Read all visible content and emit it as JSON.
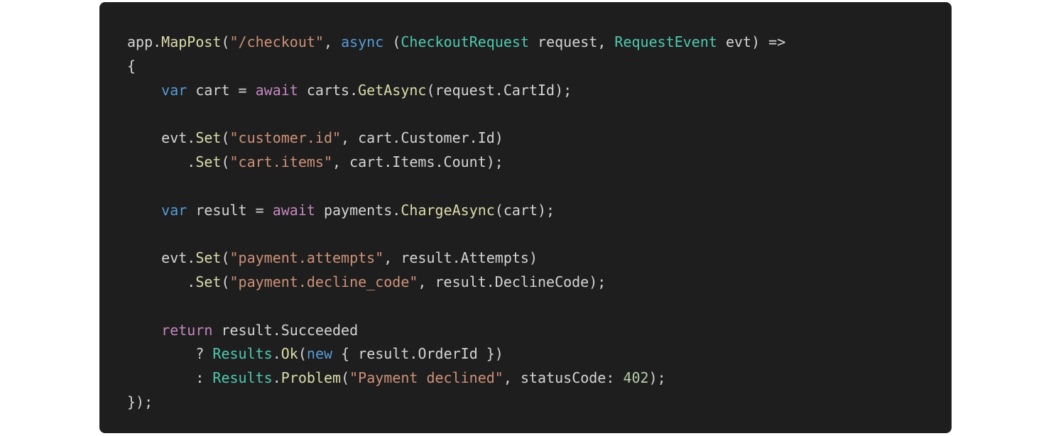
{
  "code_block": {
    "language": "csharp",
    "colors": {
      "background": "#1e1e1e",
      "plain": "#d4d4d4",
      "method": "#dcdcaa",
      "string": "#ce9178",
      "keyword": "#569cd6",
      "control": "#c586c0",
      "type": "#4ec9b0",
      "number": "#b5cea8"
    },
    "lines": [
      [
        {
          "t": "app.",
          "k": "plain"
        },
        {
          "t": "MapPost",
          "k": "method"
        },
        {
          "t": "(",
          "k": "plain"
        },
        {
          "t": "\"/checkout\"",
          "k": "string"
        },
        {
          "t": ", ",
          "k": "plain"
        },
        {
          "t": "async",
          "k": "keyword"
        },
        {
          "t": " (",
          "k": "plain"
        },
        {
          "t": "CheckoutRequest",
          "k": "type"
        },
        {
          "t": " request, ",
          "k": "plain"
        },
        {
          "t": "RequestEvent",
          "k": "type"
        },
        {
          "t": " evt) =>",
          "k": "plain"
        }
      ],
      [
        {
          "t": "{",
          "k": "plain"
        }
      ],
      [
        {
          "t": "    ",
          "k": "plain"
        },
        {
          "t": "var",
          "k": "keyword"
        },
        {
          "t": " cart = ",
          "k": "plain"
        },
        {
          "t": "await",
          "k": "control"
        },
        {
          "t": " carts.",
          "k": "plain"
        },
        {
          "t": "GetAsync",
          "k": "method"
        },
        {
          "t": "(request.CartId);",
          "k": "plain"
        }
      ],
      [],
      [
        {
          "t": "    evt.",
          "k": "plain"
        },
        {
          "t": "Set",
          "k": "method"
        },
        {
          "t": "(",
          "k": "plain"
        },
        {
          "t": "\"customer.id\"",
          "k": "string"
        },
        {
          "t": ", cart.Customer.Id)",
          "k": "plain"
        }
      ],
      [
        {
          "t": "       .",
          "k": "plain"
        },
        {
          "t": "Set",
          "k": "method"
        },
        {
          "t": "(",
          "k": "plain"
        },
        {
          "t": "\"cart.items\"",
          "k": "string"
        },
        {
          "t": ", cart.Items.Count);",
          "k": "plain"
        }
      ],
      [],
      [
        {
          "t": "    ",
          "k": "plain"
        },
        {
          "t": "var",
          "k": "keyword"
        },
        {
          "t": " result = ",
          "k": "plain"
        },
        {
          "t": "await",
          "k": "control"
        },
        {
          "t": " payments.",
          "k": "plain"
        },
        {
          "t": "ChargeAsync",
          "k": "method"
        },
        {
          "t": "(cart);",
          "k": "plain"
        }
      ],
      [],
      [
        {
          "t": "    evt.",
          "k": "plain"
        },
        {
          "t": "Set",
          "k": "method"
        },
        {
          "t": "(",
          "k": "plain"
        },
        {
          "t": "\"payment.attempts\"",
          "k": "string"
        },
        {
          "t": ", result.Attempts)",
          "k": "plain"
        }
      ],
      [
        {
          "t": "       .",
          "k": "plain"
        },
        {
          "t": "Set",
          "k": "method"
        },
        {
          "t": "(",
          "k": "plain"
        },
        {
          "t": "\"payment.decline_code\"",
          "k": "string"
        },
        {
          "t": ", result.DeclineCode);",
          "k": "plain"
        }
      ],
      [],
      [
        {
          "t": "    ",
          "k": "plain"
        },
        {
          "t": "return",
          "k": "control"
        },
        {
          "t": " result.Succeeded",
          "k": "plain"
        }
      ],
      [
        {
          "t": "        ? ",
          "k": "plain"
        },
        {
          "t": "Results",
          "k": "type"
        },
        {
          "t": ".",
          "k": "plain"
        },
        {
          "t": "Ok",
          "k": "method"
        },
        {
          "t": "(",
          "k": "plain"
        },
        {
          "t": "new",
          "k": "keyword"
        },
        {
          "t": " { result.OrderId })",
          "k": "plain"
        }
      ],
      [
        {
          "t": "        : ",
          "k": "plain"
        },
        {
          "t": "Results",
          "k": "type"
        },
        {
          "t": ".",
          "k": "plain"
        },
        {
          "t": "Problem",
          "k": "method"
        },
        {
          "t": "(",
          "k": "plain"
        },
        {
          "t": "\"Payment declined\"",
          "k": "string"
        },
        {
          "t": ", statusCode: ",
          "k": "plain"
        },
        {
          "t": "402",
          "k": "number"
        },
        {
          "t": ");",
          "k": "plain"
        }
      ],
      [
        {
          "t": "});",
          "k": "plain"
        }
      ]
    ]
  }
}
